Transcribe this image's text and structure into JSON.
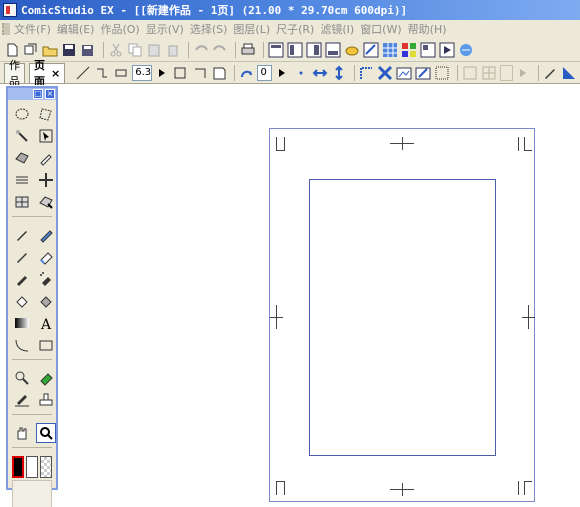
{
  "window": {
    "title": "ComicStudio EX - [[新建作品 - 1页] (21.00 * 29.70cm 600dpi)]"
  },
  "menu": {
    "items": [
      {
        "label": "文件(F)"
      },
      {
        "label": "编辑(E)"
      },
      {
        "label": "作品(O)"
      },
      {
        "label": "显示(V)"
      },
      {
        "label": "选择(S)"
      },
      {
        "label": "图层(L)"
      },
      {
        "label": "尺子(R)"
      },
      {
        "label": "滤镜(I)"
      },
      {
        "label": "窗口(W)"
      },
      {
        "label": "帮助(H)"
      }
    ]
  },
  "tabs": [
    {
      "label": "作品"
    },
    {
      "label": "页面",
      "close": "×"
    }
  ],
  "properties": {
    "brush_size": "6.3",
    "rotation_angle": "0"
  },
  "colors": {
    "titlebar_start": "#2a5cc4",
    "titlebar_end": "#7faaf0",
    "chrome": "#ece9d8",
    "palette_border": "#7f9ae0",
    "page_border": "#7a8acb",
    "frame_border": "#4a5fa8"
  },
  "palette": {
    "header_buttons": [
      "□",
      "×"
    ],
    "tools": [
      "ellipse-select-icon",
      "lasso-select-icon",
      "magic-wand-icon",
      "object-select-icon",
      "select-pen-icon",
      "eyedropper-icon",
      "ruler-icon",
      "move-icon",
      "frame-ruler-icon",
      "pattern-select-icon",
      "pen-icon",
      "pencil-icon",
      "marker-icon",
      "eraser-icon",
      "brush-icon",
      "airbrush-icon",
      "fill-icon",
      "pattern-brush-icon",
      "gradient-icon",
      "text-icon",
      "curve-icon",
      "rectangle-icon",
      "tone-select-icon",
      "tone-eraser-icon",
      "pen-tool-icon",
      "stamp-icon",
      "hand-icon",
      "zoom-icon"
    ],
    "selected_tool": "zoom-icon"
  }
}
